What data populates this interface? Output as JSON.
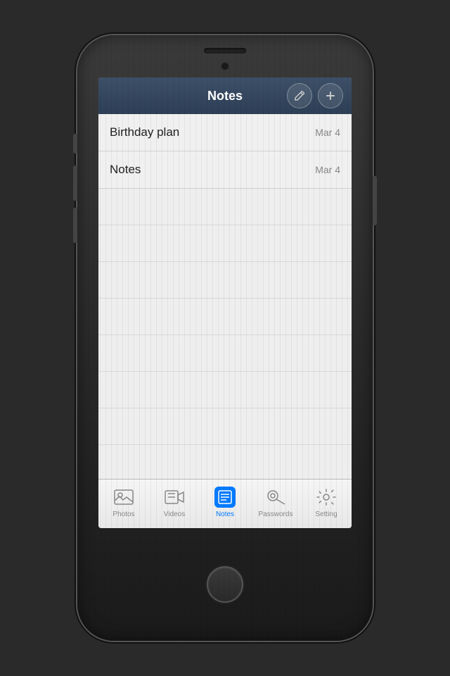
{
  "app": {
    "title": "Notes",
    "background": "#2a2a2a"
  },
  "nav": {
    "title": "Notes",
    "edit_label": "✏",
    "add_label": "+"
  },
  "notes": [
    {
      "title": "Birthday plan",
      "date": "Mar 4"
    },
    {
      "title": "Notes",
      "date": "Mar 4"
    }
  ],
  "tabs": [
    {
      "id": "photos",
      "label": "Photos",
      "active": false
    },
    {
      "id": "videos",
      "label": "Videos",
      "active": false
    },
    {
      "id": "notes",
      "label": "Notes",
      "active": true
    },
    {
      "id": "passwords",
      "label": "Passwords",
      "active": false
    },
    {
      "id": "setting",
      "label": "Setting",
      "active": false
    }
  ],
  "colors": {
    "active_tab": "#007aff",
    "nav_bg_start": "#3d5068",
    "nav_bg_end": "#2d3f56"
  }
}
